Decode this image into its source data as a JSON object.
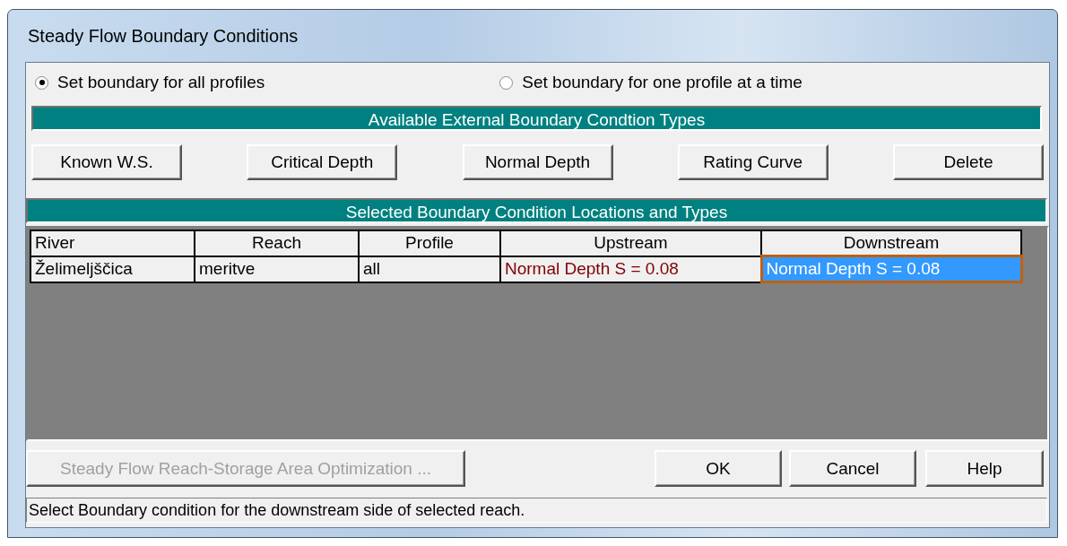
{
  "window": {
    "title": "Steady Flow Boundary Conditions"
  },
  "profile_mode": [
    {
      "label": "Set boundary for all profiles",
      "selected": true
    },
    {
      "label": "Set boundary for one profile at a time",
      "selected": false
    }
  ],
  "types_header": "Available External Boundary Condtion Types",
  "type_buttons": [
    "Known W.S.",
    "Critical Depth",
    "Normal Depth",
    "Rating Curve",
    "Delete"
  ],
  "locations_header": "Selected Boundary Condition Locations and Types",
  "table": {
    "columns": [
      "River",
      "Reach",
      "Profile",
      "Upstream",
      "Downstream"
    ],
    "rows": [
      {
        "cells": [
          {
            "text": "Želimeljščica",
            "kind": "plain",
            "selected": false
          },
          {
            "text": "meritve",
            "kind": "plain",
            "selected": false
          },
          {
            "text": "all",
            "kind": "plain",
            "selected": false
          },
          {
            "text": "Normal Depth S = 0.08",
            "kind": "boundary",
            "selected": false
          },
          {
            "text": "Normal Depth S = 0.08",
            "kind": "boundary",
            "selected": true
          }
        ]
      }
    ]
  },
  "optimize_button": {
    "label": "Steady Flow Reach-Storage Area Optimization ...",
    "disabled": true
  },
  "dialog_buttons": [
    "OK",
    "Cancel",
    "Help"
  ],
  "status_bar": "Select Boundary condition for the downstream side of selected reach."
}
